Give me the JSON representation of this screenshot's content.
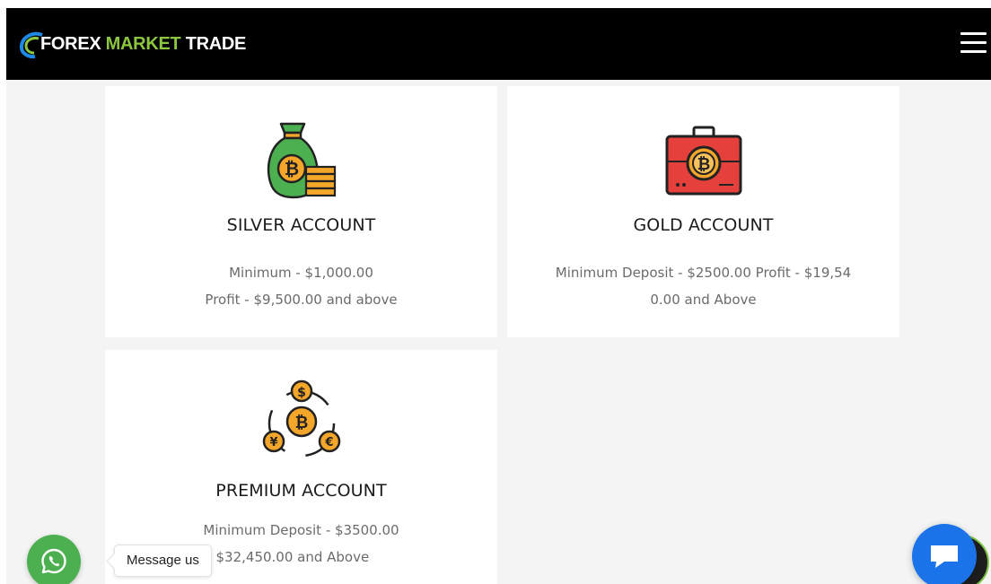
{
  "header": {
    "logo_forex": "FOREX",
    "logo_market": "MARKET",
    "logo_trade": "TRADE"
  },
  "plans": [
    {
      "title": "SILVER ACCOUNT",
      "line1": "Minimum - $1,000.00",
      "line2": "Profit - $9,500.00 and above",
      "icon": "bitcoin-money-bag-icon"
    },
    {
      "title": "GOLD ACCOUNT",
      "line1": "Minimum Deposit - $2500.00 Profit - $19,54",
      "line2": "0.00 and Above",
      "icon": "bitcoin-briefcase-icon"
    },
    {
      "title": "PREMIUM ACCOUNT",
      "line1": "Minimum Deposit - $3500.00",
      "line2": "fit- $32,450.00 and Above",
      "icon": "currency-exchange-icon"
    }
  ],
  "widgets": {
    "whatsapp_message": "Message us"
  },
  "colors": {
    "navbar": "#000000",
    "brand_green": "#8cc63f",
    "whatsapp_green": "#4caf50",
    "chat_blue": "#1a73e8",
    "page_bg": "#f3f4f3"
  }
}
